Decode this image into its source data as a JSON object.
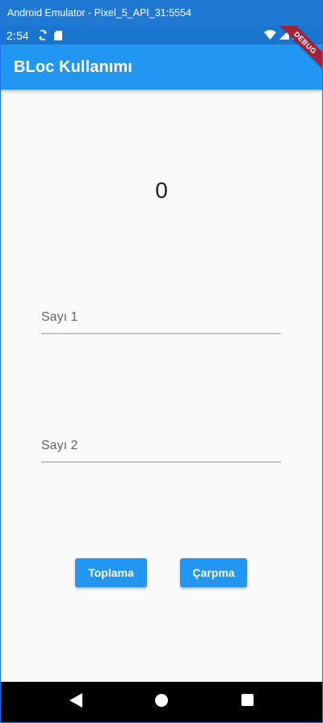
{
  "window": {
    "title": "Android Emulator - Pixel_5_API_31:5554"
  },
  "status_bar": {
    "time": "2:54"
  },
  "debug_banner": "DEBUG",
  "app_bar": {
    "title": "BLoc Kullanımı"
  },
  "counter": {
    "value": "0"
  },
  "inputs": {
    "sayi1": {
      "placeholder": "Sayı 1",
      "value": ""
    },
    "sayi2": {
      "placeholder": "Sayı 2",
      "value": ""
    }
  },
  "buttons": {
    "add_label": "Toplama",
    "multiply_label": "Çarpma"
  },
  "colors": {
    "primary": "#2196f3",
    "status_bar": "#1a75cf",
    "debug": "#a3213a"
  },
  "icons": [
    "sync-icon",
    "sd-card-icon",
    "wifi-icon",
    "signal-icon",
    "battery-icon",
    "back-icon",
    "home-icon",
    "recents-icon"
  ]
}
